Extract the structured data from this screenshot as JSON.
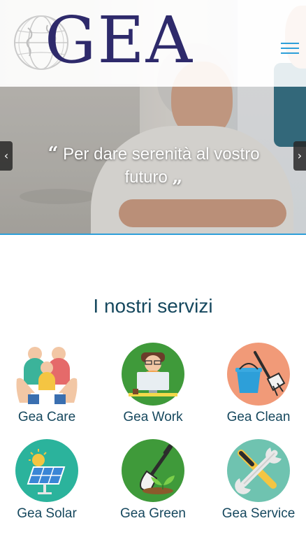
{
  "header": {
    "brand": "GEA",
    "logo_icon": "globe-icon",
    "menu_icon": "hamburger-menu-icon"
  },
  "hero": {
    "quote_open": "“",
    "quote_text": "Per dare serenità al vostro futuro",
    "quote_close": "„",
    "prev_arrow": "‹",
    "next_arrow": "›",
    "accent_color": "#2d9fd9"
  },
  "services": {
    "title": "I nostri servizi",
    "items": [
      {
        "label": "Gea Care",
        "icon": "family-care-icon"
      },
      {
        "label": "Gea Work",
        "icon": "computer-work-icon"
      },
      {
        "label": "Gea Clean",
        "icon": "bucket-broom-icon"
      },
      {
        "label": "Gea Solar",
        "icon": "solar-panel-icon"
      },
      {
        "label": "Gea Green",
        "icon": "shovel-plant-icon"
      },
      {
        "label": "Gea Service",
        "icon": "wrench-screwdriver-icon"
      }
    ],
    "text_color": "#16485e"
  }
}
